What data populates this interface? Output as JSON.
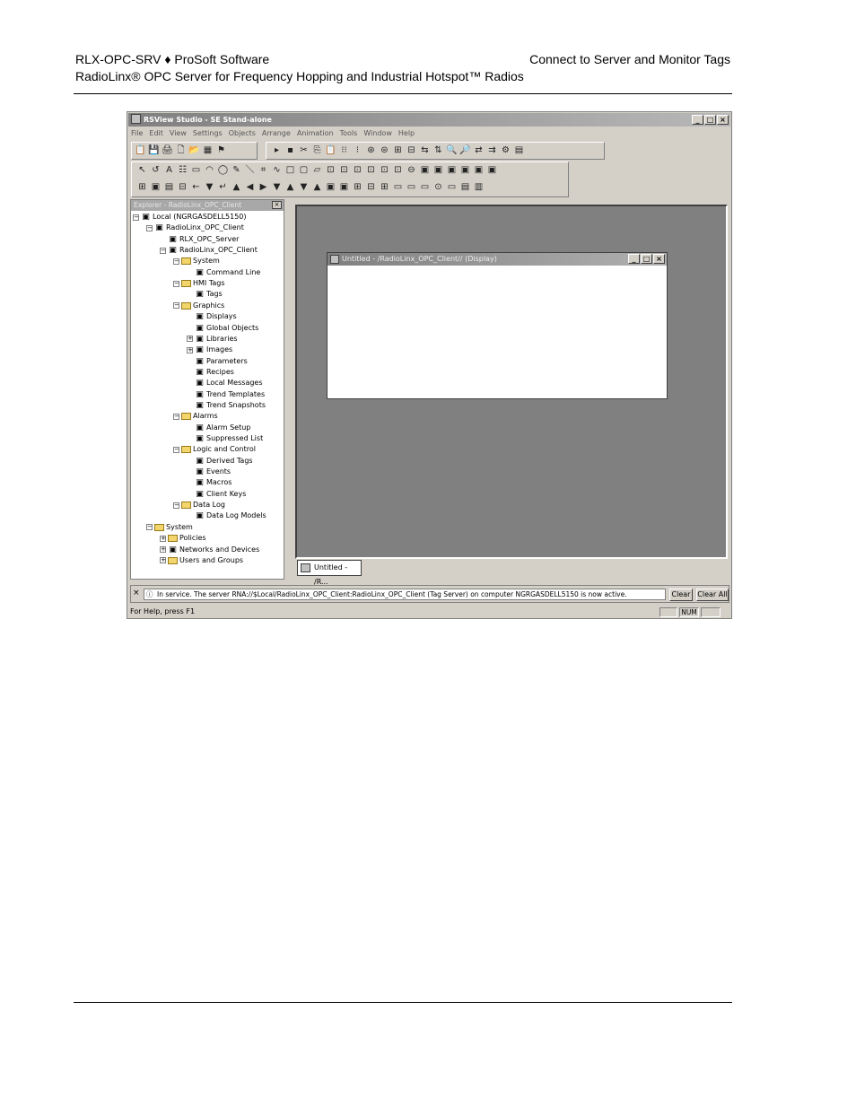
{
  "header": {
    "left_line1": "RLX-OPC-SRV ♦ ProSoft Software",
    "right_line1": "Connect to Server and Monitor Tags",
    "left_line2": "RadioLinx® OPC Server for Frequency Hopping and Industrial Hotspot™ Radios"
  },
  "app": {
    "title": "RSView Studio - SE Stand-alone",
    "window_buttons": [
      "_",
      "□",
      "×"
    ],
    "menu": [
      "File",
      "Edit",
      "View",
      "Settings",
      "Objects",
      "Arrange",
      "Animation",
      "Tools",
      "Window",
      "Help"
    ],
    "toolbar1_icons": [
      "📋",
      "💾",
      "🖨",
      "🗋",
      "📂",
      "▦",
      "⚑"
    ],
    "toolbar2_icons": [
      "▸",
      "▪",
      "✂",
      "⎘",
      "📋",
      "⁝⁝",
      "⁝",
      "⊛",
      "⊜",
      "⊞",
      "⊟",
      "⇆",
      "⇅",
      "🔍",
      "🔎",
      "⇄",
      "⇉",
      "⚙",
      "▤"
    ],
    "toolbar3_icons": [
      "↖",
      "↺",
      "A",
      "☷",
      "▭",
      "◠",
      "◯",
      "✎",
      "＼",
      "⌗",
      "∿",
      "□",
      "▢",
      "▱",
      "⊡",
      "⊡",
      "⊡",
      "⊡",
      "⊡",
      "⊡",
      "⊖",
      "▣",
      "▣",
      "▣",
      "▣",
      "▣",
      "▣"
    ],
    "toolbar4_icons": [
      "⊞",
      "▣",
      "▤",
      "⊟",
      "←",
      "▼",
      "↵",
      "▲",
      "◀",
      "▶",
      "▼",
      "▲",
      "▼",
      "▲",
      "▣",
      "▣",
      "⊞",
      "⊟",
      "⊞",
      "▭",
      "▭",
      "▭",
      "⊙",
      "▭",
      "▤",
      "▥"
    ],
    "explorer": {
      "title": "Explorer - RadioLinx_OPC_Client",
      "nodes": [
        {
          "label": "Local (NGRGASDELL5150)",
          "pm": "−"
        },
        {
          "label": "RadioLinx_OPC_Client",
          "pm": "−"
        },
        {
          "label": "RLX_OPC_Server",
          "pm": ""
        },
        {
          "label": "RadioLinx_OPC_Client",
          "pm": "−"
        },
        {
          "label": "System",
          "pm": "−"
        },
        {
          "label": "Command Line",
          "pm": ""
        },
        {
          "label": "HMI Tags",
          "pm": "−"
        },
        {
          "label": "Tags",
          "pm": ""
        },
        {
          "label": "Graphics",
          "pm": "−"
        },
        {
          "label": "Displays",
          "pm": ""
        },
        {
          "label": "Global Objects",
          "pm": ""
        },
        {
          "label": "Libraries",
          "pm": "+"
        },
        {
          "label": "Images",
          "pm": "+"
        },
        {
          "label": "Parameters",
          "pm": ""
        },
        {
          "label": "Recipes",
          "pm": ""
        },
        {
          "label": "Local Messages",
          "pm": ""
        },
        {
          "label": "Trend Templates",
          "pm": ""
        },
        {
          "label": "Trend Snapshots",
          "pm": ""
        },
        {
          "label": "Alarms",
          "pm": "−"
        },
        {
          "label": "Alarm Setup",
          "pm": ""
        },
        {
          "label": "Suppressed List",
          "pm": ""
        },
        {
          "label": "Logic and Control",
          "pm": "−"
        },
        {
          "label": "Derived Tags",
          "pm": ""
        },
        {
          "label": "Events",
          "pm": ""
        },
        {
          "label": "Macros",
          "pm": ""
        },
        {
          "label": "Client Keys",
          "pm": ""
        },
        {
          "label": "Data Log",
          "pm": "−"
        },
        {
          "label": "Data Log Models",
          "pm": ""
        },
        {
          "label": "System",
          "pm": "−"
        },
        {
          "label": "Policies",
          "pm": "+"
        },
        {
          "label": "Networks and Devices",
          "pm": "+"
        },
        {
          "label": "Users and Groups",
          "pm": "+"
        }
      ]
    },
    "display_window": {
      "title": "Untitled - /RadioLinx_OPC_Client// (Display)"
    },
    "tab_label": "Untitled - /R...",
    "diagnostics": {
      "message": "In service. The server RNA://$Local/RadioLinx_OPC_Client:RadioLinx_OPC_Client (Tag Server) on computer NGRGASDELL5150 is now active.",
      "clear_label": "Clear",
      "clear_all_label": "Clear All"
    },
    "status": {
      "help_text": "For Help, press F1",
      "num": "NUM"
    }
  }
}
